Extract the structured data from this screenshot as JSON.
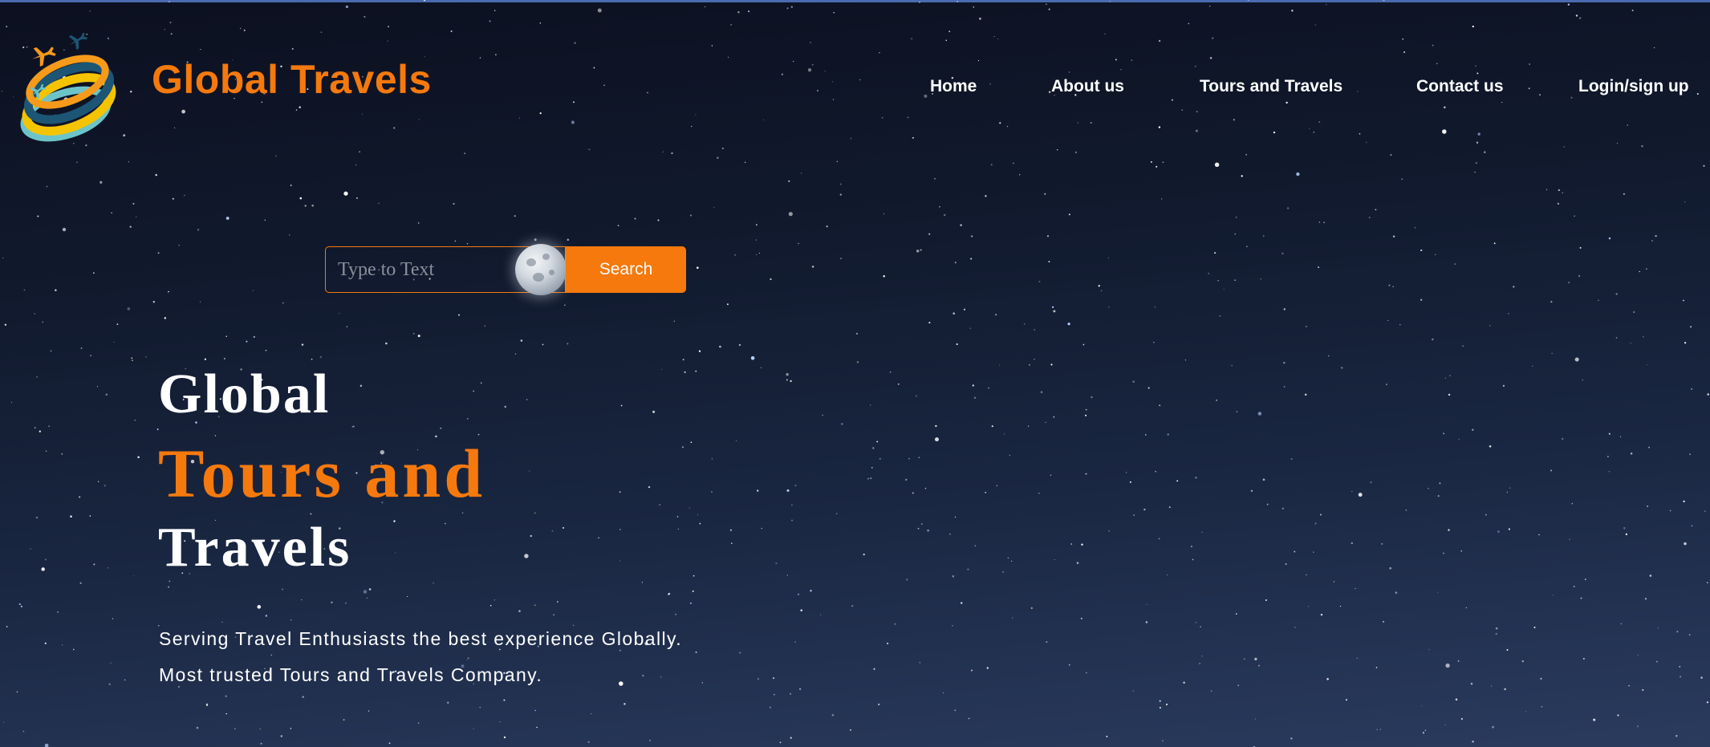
{
  "brand": {
    "name": "Global Travels",
    "logo_icon": "globe-with-airplanes-logo"
  },
  "nav": {
    "items": [
      {
        "label": "Home"
      },
      {
        "label": "About us"
      },
      {
        "label": "Tours and Travels"
      },
      {
        "label": "Contact us"
      },
      {
        "label": "Login/sign up"
      }
    ]
  },
  "search": {
    "placeholder": "Type to Text",
    "value": "",
    "button_label": "Search"
  },
  "hero": {
    "line1": "Global",
    "line2": "Tours and",
    "line3": "Travels",
    "tagline1": "Serving Travel Enthusiasts the best experience Globally.",
    "tagline2": "Most trusted Tours and Travels Company."
  },
  "colors": {
    "accent": "#f5790d",
    "text": "#ffffff",
    "background_top": "#0c1020",
    "background_bottom": "#2a3b5e"
  }
}
